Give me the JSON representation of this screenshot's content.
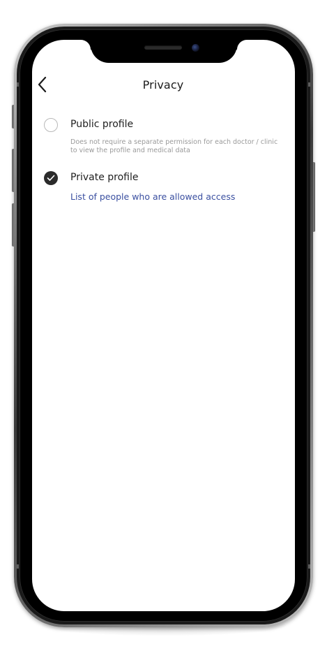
{
  "header": {
    "title": "Privacy",
    "back_icon": "chevron-left-icon"
  },
  "options": [
    {
      "label": "Public profile",
      "description": "Does not require a separate permission for each doctor / clinic to view the profile and medical data",
      "selected": false
    },
    {
      "label": "Private profile",
      "selected": true,
      "link_label": "List of people who are allowed access"
    }
  ],
  "colors": {
    "link": "#3a4fa0",
    "radio_selected": "#2b2b2b",
    "radio_unselected_border": "#b9b9b9",
    "description": "#9a9a9a"
  }
}
